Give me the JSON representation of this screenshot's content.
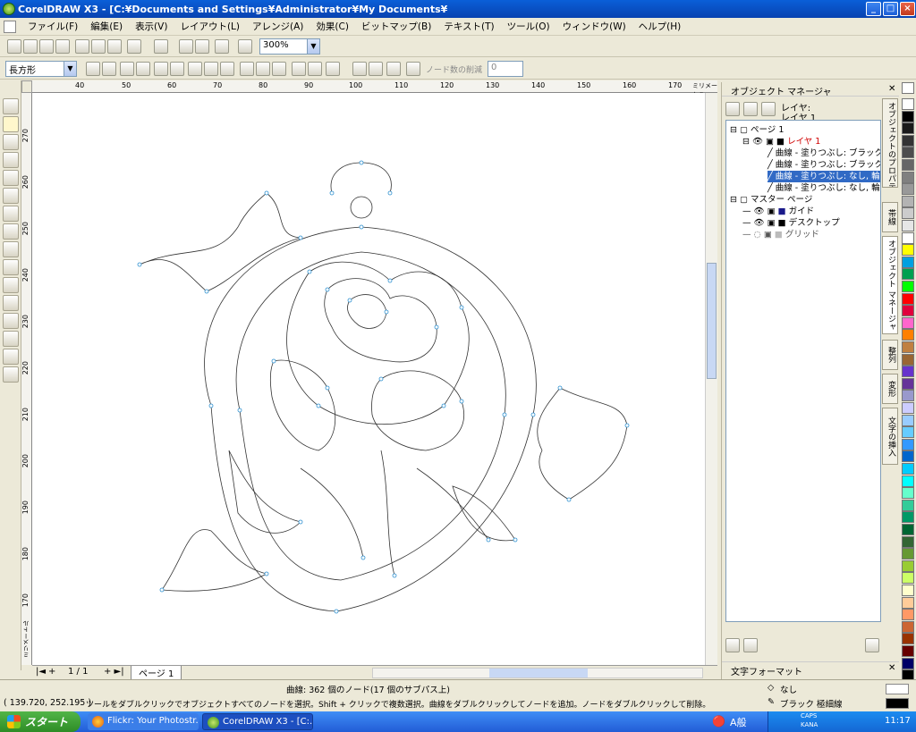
{
  "window": {
    "title": "CorelDRAW X3 - [C:¥Documents and Settings¥Administrator¥My Documents¥"
  },
  "menu": [
    "ファイル(F)",
    "編集(E)",
    "表示(V)",
    "レイアウト(L)",
    "アレンジ(A)",
    "効果(C)",
    "ビットマップ(B)",
    "テキスト(T)",
    "ツール(O)",
    "ウィンドウ(W)",
    "ヘルプ(H)"
  ],
  "toolbar": {
    "zoom": "300%"
  },
  "property_bar": {
    "shape_combo": "長方形",
    "node_reduce_label": "ノード数の削減",
    "node_reduce_value": "0"
  },
  "ruler": {
    "h_ticks": [
      "40",
      "50",
      "60",
      "70",
      "80",
      "90",
      "100",
      "110",
      "120",
      "130",
      "140",
      "150",
      "160",
      "170"
    ],
    "h_unit": "ミリメートル",
    "v_ticks": [
      "270",
      "260",
      "250",
      "240",
      "230",
      "220",
      "210",
      "200",
      "190",
      "180",
      "170"
    ],
    "v_unit": "ミリメートル"
  },
  "pagebar": {
    "page_count": "1 / 1",
    "page_tab": "ページ 1"
  },
  "object_manager": {
    "title": "オブジェクト マネージャ",
    "layer_label": "レイヤ:",
    "layer_name": "レイヤ 1",
    "tree": {
      "page": "ページ 1",
      "layer": "レイヤ 1",
      "curves": [
        "曲線 - 塗りつぶし: ブラック, 輪",
        "曲線 - 塗りつぶし: ブラック, 輪",
        "曲線 - 塗りつぶし: なし, 輪郭",
        "曲線 - 塗りつぶし: なし, 輪郭"
      ],
      "master": "マスター ページ",
      "master_items": [
        "ガイド",
        "デスクトップ",
        "グリッド"
      ]
    }
  },
  "docker_tabs": [
    "オブジェクトのプロパティ",
    "帯線",
    "オブジェクト マネージャ",
    "整列",
    "変形",
    "文字の挿入"
  ],
  "text_format": {
    "title": "文字フォーマット"
  },
  "fill_status": {
    "fill": "なし",
    "outline": "ブラック 極細線"
  },
  "status": {
    "object_info": "曲線: 362 個のノード(17 個のサブパス上)",
    "coords": "( 139.720, 252.195 )",
    "hint": "ツールをダブルクリックでオブジェクトすべてのノードを選択。Shift + クリックで複数選択。曲線をダブルクリックしてノードを追加。ノードをダブルクリックして削除。"
  },
  "taskbar": {
    "start": "スタート",
    "tasks": [
      "Flickr: Your Photostr...",
      "CorelDRAW X3 - [C:..."
    ],
    "time": "11:17",
    "ime": "A般",
    "caps": "CAPS",
    "kana": "KANA"
  },
  "palette": [
    "#ffffff",
    "#000000",
    "#1a1a1a",
    "#333333",
    "#4d4d4d",
    "#666666",
    "#808080",
    "#999999",
    "#b3b3b3",
    "#cccccc",
    "#e6e6e6",
    "#ffffff",
    "#ffff00",
    "#00a0e0",
    "#00a050",
    "#00ff00",
    "#ff0000",
    "#e0003c",
    "#ff66cc",
    "#ff8000",
    "#c08040",
    "#996633",
    "#6633cc",
    "#663399",
    "#9999cc",
    "#ccccff",
    "#99ccff",
    "#66ccff",
    "#3399ff",
    "#0066cc",
    "#00ccff",
    "#00ffff",
    "#66ffcc",
    "#33cc99",
    "#009966",
    "#006633",
    "#336633",
    "#669933",
    "#99cc33",
    "#ccff66",
    "#ffffcc",
    "#ffcc99",
    "#ff9966",
    "#cc6633",
    "#993300",
    "#660000",
    "#000066",
    "#000000"
  ]
}
